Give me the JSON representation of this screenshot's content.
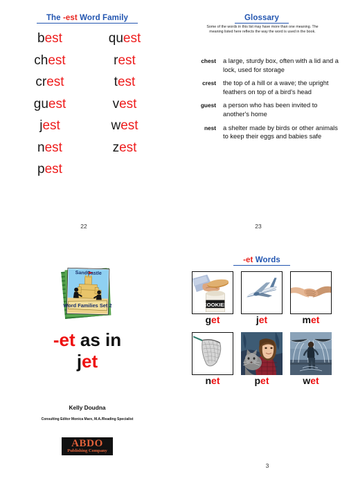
{
  "document": {
    "kind": "book-page-spread",
    "colors": {
      "heading_blue": "#2255b0",
      "accent_red": "#ee1d1d",
      "text_black": "#111111",
      "abdo_orange": "#e0613a"
    }
  },
  "spread_top": {
    "left_page": {
      "folio": "22",
      "heading": {
        "before": "The ",
        "accent": "-est",
        "after": " Word Family"
      },
      "columns": [
        [
          {
            "black": "b",
            "red": "est"
          },
          {
            "black": "ch",
            "red": "est"
          },
          {
            "black": "cr",
            "red": "est"
          },
          {
            "black": "gu",
            "red": "est"
          },
          {
            "black": "j",
            "red": "est"
          },
          {
            "black": "n",
            "red": "est"
          },
          {
            "black": "p",
            "red": "est"
          }
        ],
        [
          {
            "black": "qu",
            "red": "est"
          },
          {
            "black": "r",
            "red": "est"
          },
          {
            "black": "t",
            "red": "est"
          },
          {
            "black": "v",
            "red": "est"
          },
          {
            "black": "w",
            "red": "est"
          },
          {
            "black": "z",
            "red": "est"
          }
        ]
      ]
    },
    "right_page": {
      "folio": "23",
      "heading": {
        "before": "",
        "accent": "",
        "after": "Glossary"
      },
      "note": "Some of the words in this list may have more than one meaning. The meaning listed here reflects the way the word is used in the book.",
      "entries": [
        {
          "term": "chest",
          "definition": "a large, sturdy box, often with a lid and a lock, used for storage"
        },
        {
          "term": "crest",
          "definition": "the top of a hill or a wave; the upright feathers on top of a bird's head"
        },
        {
          "term": "guest",
          "definition": "a person who has been invited to another's home"
        },
        {
          "term": "nest",
          "definition": "a shelter made by birds or other animals to keep their eggs and babies safe"
        }
      ]
    }
  },
  "spread_bottom": {
    "left_page": {
      "series_logo": {
        "brand": "SandCastle",
        "set_banner": "Word Families Set 2"
      },
      "title": {
        "line1_black_lead": "-",
        "line1_accent": "et",
        "line1_rest": " as in",
        "line2_black": "j",
        "line2_accent": "et"
      },
      "author": "Kelly Doudna",
      "editor_line": "Consulting Editor Monica Marx, M.A./Reading Specialist",
      "publisher": {
        "name": "ABDO",
        "tagline": "Publishing Company"
      }
    },
    "right_page": {
      "folio": "3",
      "heading": {
        "before": "",
        "accent": "-et",
        "after": " Words"
      },
      "cells": [
        {
          "black": "g",
          "red": "et",
          "image": "hand-in-cookie-jar-photo",
          "framed": true
        },
        {
          "black": "j",
          "red": "et",
          "image": "airplane-photo",
          "framed": true
        },
        {
          "black": "m",
          "red": "et",
          "image": "handshake-photo",
          "framed": true
        },
        {
          "black": "n",
          "red": "et",
          "image": "fishing-net-photo",
          "framed": true
        },
        {
          "black": "p",
          "red": "et",
          "image": "girl-with-cat-photo",
          "framed": false
        },
        {
          "black": "w",
          "red": "et",
          "image": "child-in-fountain-photo",
          "framed": false
        }
      ]
    }
  }
}
